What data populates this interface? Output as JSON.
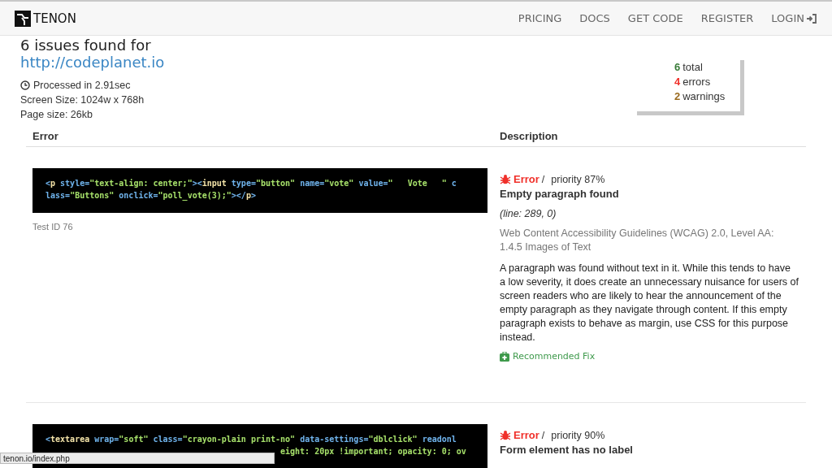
{
  "nav": {
    "brand": "TENON",
    "links": [
      {
        "label": "PRICING"
      },
      {
        "label": "DOCS"
      },
      {
        "label": "GET CODE"
      },
      {
        "label": "REGISTER"
      },
      {
        "label": "LOGIN"
      }
    ]
  },
  "heading": {
    "title": "6 issues found for",
    "url": "http://codeplanet.io"
  },
  "meta": {
    "processed": "Processed in 2.91sec",
    "screen": "Screen Size: 1024w x 768h",
    "page": "Page size: 26kb"
  },
  "summary": [
    {
      "count": "6",
      "label": "total",
      "color": "#3a7d3a"
    },
    {
      "count": "4",
      "label": "errors",
      "color": "#f0302a"
    },
    {
      "count": "2",
      "label": "warnings",
      "color": "#9a6a1e"
    }
  ],
  "table": {
    "columns": [
      "Error",
      "Description"
    ]
  },
  "issues": [
    {
      "code": [
        [
          {
            "t": "<",
            "kind": "punct"
          },
          {
            "t": "p",
            "kind": "tag"
          },
          {
            "t": " style",
            "kind": "attr"
          },
          {
            "t": "=",
            "kind": "punct"
          },
          {
            "t": "\"text-align: center;\"",
            "kind": "value"
          },
          {
            "t": "><",
            "kind": "punct"
          },
          {
            "t": "input",
            "kind": "tag"
          },
          {
            "t": " type",
            "kind": "attr"
          },
          {
            "t": "=",
            "kind": "punct"
          },
          {
            "t": "\"button\"",
            "kind": "value"
          },
          {
            "t": " name",
            "kind": "attr"
          },
          {
            "t": "=",
            "kind": "punct"
          },
          {
            "t": "\"vote\"",
            "kind": "value"
          },
          {
            "t": " value",
            "kind": "attr"
          },
          {
            "t": "=",
            "kind": "punct"
          },
          {
            "t": "\"   Vote   \"",
            "kind": "value"
          },
          {
            "t": " c",
            "kind": "attr"
          }
        ],
        [
          {
            "t": "lass",
            "kind": "attr"
          },
          {
            "t": "=",
            "kind": "punct"
          },
          {
            "t": "\"Buttons\"",
            "kind": "value"
          },
          {
            "t": " onclick",
            "kind": "attr"
          },
          {
            "t": "=",
            "kind": "punct"
          },
          {
            "t": "\"poll_vote(3);\"",
            "kind": "value"
          },
          {
            "t": "></",
            "kind": "punct"
          },
          {
            "t": "p",
            "kind": "tag"
          },
          {
            "t": ">",
            "kind": "punct"
          }
        ]
      ],
      "test_id": "Test ID 76",
      "severity": "Error",
      "separator": "/",
      "color": "#f0302a",
      "priority": "priority 87%",
      "title": "Empty paragraph found",
      "line": "(line: 289, 0)",
      "guideline": "Web Content Accessibility Guidelines (WCAG) 2.0, Level AA: 1.4.5 Images of Text",
      "description": "A paragraph was found without text in it. While this tends to have a low severity, it does create an unnecessary nuisance for users of screen readers who are likely to hear the announcement of the empty paragraph as they navigate through content. If this empty paragraph exists to behave as margin, use CSS for this purpose instead.",
      "fix": "Recommended Fix"
    },
    {
      "code": [
        [
          {
            "t": "<",
            "kind": "punct"
          },
          {
            "t": "textarea",
            "kind": "tag"
          },
          {
            "t": " wrap",
            "kind": "attr"
          },
          {
            "t": "=",
            "kind": "punct"
          },
          {
            "t": "\"soft\"",
            "kind": "value"
          },
          {
            "t": " class",
            "kind": "attr"
          },
          {
            "t": "=",
            "kind": "punct"
          },
          {
            "t": "\"crayon-plain print-no\"",
            "kind": "value"
          },
          {
            "t": " data-settings",
            "kind": "attr"
          },
          {
            "t": "=",
            "kind": "punct"
          },
          {
            "t": "\"dblclick\"",
            "kind": "value"
          },
          {
            "t": " readonl",
            "kind": "attr"
          }
        ],
        [
          {
            "t": "eight: 20px !important; opacity: 0; ov",
            "kind": "value"
          }
        ]
      ],
      "code_covered": true,
      "severity": "Error",
      "separator": "/",
      "color": "#f0302a",
      "priority": "priority 90%",
      "title": "Form element has no label"
    }
  ],
  "status_bar": "tenon.io/index.php"
}
